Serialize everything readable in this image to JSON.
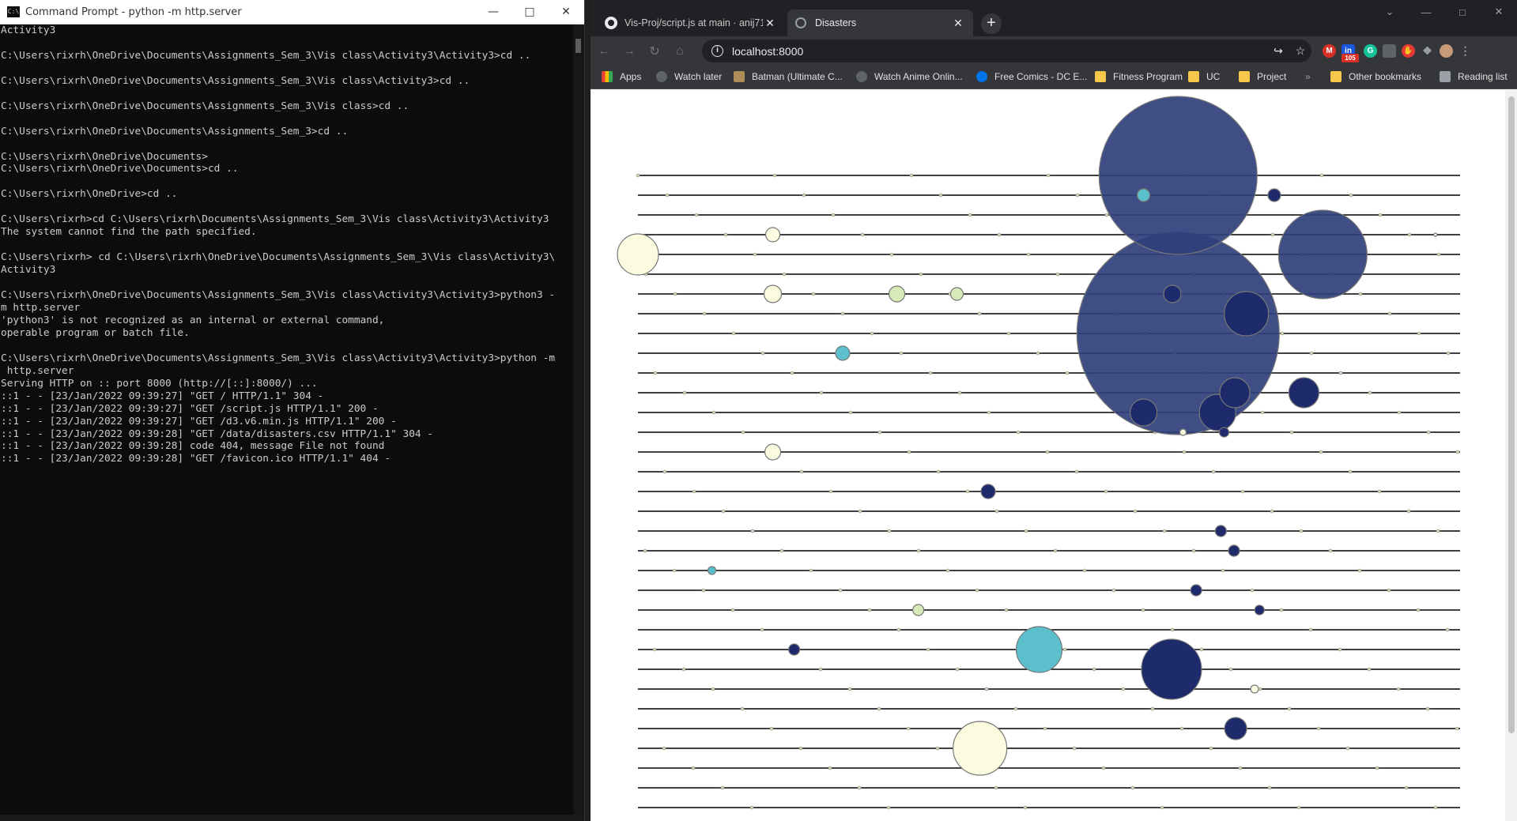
{
  "cmd": {
    "title": "Command Prompt - python  -m http.server",
    "lines": [
      "Activity3",
      "",
      "C:\\Users\\rixrh\\OneDrive\\Documents\\Assignments_Sem_3\\Vis class\\Activity3\\Activity3>cd ..",
      "",
      "C:\\Users\\rixrh\\OneDrive\\Documents\\Assignments_Sem_3\\Vis class\\Activity3>cd ..",
      "",
      "C:\\Users\\rixrh\\OneDrive\\Documents\\Assignments_Sem_3\\Vis class>cd ..",
      "",
      "C:\\Users\\rixrh\\OneDrive\\Documents\\Assignments_Sem_3>cd ..",
      "",
      "C:\\Users\\rixrh\\OneDrive\\Documents>",
      "C:\\Users\\rixrh\\OneDrive\\Documents>cd ..",
      "",
      "C:\\Users\\rixrh\\OneDrive>cd ..",
      "",
      "C:\\Users\\rixrh>cd C:\\Users\\rixrh\\Documents\\Assignments_Sem_3\\Vis class\\Activity3\\Activity3",
      "The system cannot find the path specified.",
      "",
      "C:\\Users\\rixrh> cd C:\\Users\\rixrh\\OneDrive\\Documents\\Assignments_Sem_3\\Vis class\\Activity3\\",
      "Activity3",
      "",
      "C:\\Users\\rixrh\\OneDrive\\Documents\\Assignments_Sem_3\\Vis class\\Activity3\\Activity3>python3 -",
      "m http.server",
      "'python3' is not recognized as an internal or external command,",
      "operable program or batch file.",
      "",
      "C:\\Users\\rixrh\\OneDrive\\Documents\\Assignments_Sem_3\\Vis class\\Activity3\\Activity3>python -m",
      " http.server",
      "Serving HTTP on :: port 8000 (http://[::]:8000/) ...",
      "::1 - - [23/Jan/2022 09:39:27] \"GET / HTTP/1.1\" 304 -",
      "::1 - - [23/Jan/2022 09:39:27] \"GET /script.js HTTP/1.1\" 200 -",
      "::1 - - [23/Jan/2022 09:39:27] \"GET /d3.v6.min.js HTTP/1.1\" 200 -",
      "::1 - - [23/Jan/2022 09:39:28] \"GET /data/disasters.csv HTTP/1.1\" 304 -",
      "::1 - - [23/Jan/2022 09:39:28] code 404, message File not found",
      "::1 - - [23/Jan/2022 09:39:28] \"GET /favicon.ico HTTP/1.1\" 404 -"
    ]
  },
  "browser": {
    "tabs": [
      {
        "label": "Vis-Proj/script.js at main · anij71"
      },
      {
        "label": "Disasters"
      }
    ],
    "url": "localhost:8000",
    "bookmarks": [
      {
        "label": "Apps",
        "icon": "apps-grid-icon"
      },
      {
        "label": "Watch later",
        "icon": "globe-icon"
      },
      {
        "label": "Batman (Ultimate C...",
        "icon": "batman-icon"
      },
      {
        "label": "Watch Anime Onlin...",
        "icon": "globe-icon"
      },
      {
        "label": "Free Comics - DC E...",
        "icon": "dc-icon"
      },
      {
        "label": "Fitness Program",
        "icon": "folder-icon"
      },
      {
        "label": "UC",
        "icon": "folder-icon"
      },
      {
        "label": "Project",
        "icon": "folder-icon"
      },
      {
        "label": "»",
        "icon": "overflow-chevron"
      },
      {
        "label": "Other bookmarks",
        "icon": "folder-icon"
      },
      {
        "label": "Reading list",
        "icon": "reading-list-icon"
      }
    ],
    "extension_badge": "105"
  },
  "colors": {
    "line": "#000000",
    "bubble_dark": "#2f3f7a",
    "bubble_deep": "#1d2a6b",
    "bubble_cyan": "#5bbfcc",
    "bubble_light_green": "#d6e9b8",
    "bubble_cream": "#fbfbdf"
  },
  "chart_data": {
    "type": "scatter",
    "rows": 33,
    "x_range": [
      0,
      100
    ],
    "size_scale": "radius ∝ sqrt(value); max radius 128",
    "points": [
      {
        "row": 0,
        "x": 65.7,
        "r": 100,
        "c": "dark"
      },
      {
        "row": 1,
        "x": 61.5,
        "r": 8,
        "c": "cyan"
      },
      {
        "row": 1,
        "x": 77.4,
        "r": 8,
        "c": "deep"
      },
      {
        "row": 3,
        "x": 97,
        "r": 2,
        "c": "cream"
      },
      {
        "row": 4,
        "x": 83.3,
        "r": 56,
        "c": "dark"
      },
      {
        "row": 4,
        "x": 0,
        "r": 26,
        "c": "cream"
      },
      {
        "row": 3,
        "x": 16.4,
        "r": 9,
        "c": "cream"
      },
      {
        "row": 6,
        "x": 16.4,
        "r": 11,
        "c": "cream"
      },
      {
        "row": 6,
        "x": 31.5,
        "r": 10,
        "c": "light"
      },
      {
        "row": 6,
        "x": 38.8,
        "r": 8,
        "c": "light"
      },
      {
        "row": 6,
        "x": 65,
        "r": 11,
        "c": "deep"
      },
      {
        "row": 8,
        "x": 65.7,
        "r": 128,
        "c": "dark"
      },
      {
        "row": 7,
        "x": 74,
        "r": 28,
        "c": "deep"
      },
      {
        "row": 9,
        "x": 24.9,
        "r": 9,
        "c": "cyan"
      },
      {
        "row": 11,
        "x": 72.6,
        "r": 19,
        "c": "deep"
      },
      {
        "row": 11,
        "x": 81,
        "r": 19,
        "c": "deep"
      },
      {
        "row": 12,
        "x": 61.5,
        "r": 17,
        "c": "deep"
      },
      {
        "row": 12,
        "x": 70.5,
        "r": 23,
        "c": "deep"
      },
      {
        "row": 13,
        "x": 71.3,
        "r": 6,
        "c": "deep"
      },
      {
        "row": 13,
        "x": 66.3,
        "r": 4,
        "c": "cream"
      },
      {
        "row": 14,
        "x": 16.4,
        "r": 10,
        "c": "cream"
      },
      {
        "row": 16,
        "x": 42.6,
        "r": 9,
        "c": "deep"
      },
      {
        "row": 18,
        "x": 70.9,
        "r": 7,
        "c": "deep"
      },
      {
        "row": 19,
        "x": 72.5,
        "r": 7,
        "c": "deep"
      },
      {
        "row": 20,
        "x": 9,
        "r": 5,
        "c": "cyan"
      },
      {
        "row": 21,
        "x": 67.9,
        "r": 7,
        "c": "deep"
      },
      {
        "row": 22,
        "x": 34.1,
        "r": 7,
        "c": "light"
      },
      {
        "row": 22,
        "x": 75.6,
        "r": 6,
        "c": "deep"
      },
      {
        "row": 24,
        "x": 19,
        "r": 7,
        "c": "deep"
      },
      {
        "row": 24,
        "x": 48.8,
        "r": 29,
        "c": "cyan"
      },
      {
        "row": 25,
        "x": 64.9,
        "r": 38,
        "c": "deep"
      },
      {
        "row": 26,
        "x": 75,
        "r": 5,
        "c": "cream"
      },
      {
        "row": 28,
        "x": 72.7,
        "r": 14,
        "c": "deep"
      },
      {
        "row": 29,
        "x": 41.6,
        "r": 34,
        "c": "cream"
      }
    ]
  }
}
